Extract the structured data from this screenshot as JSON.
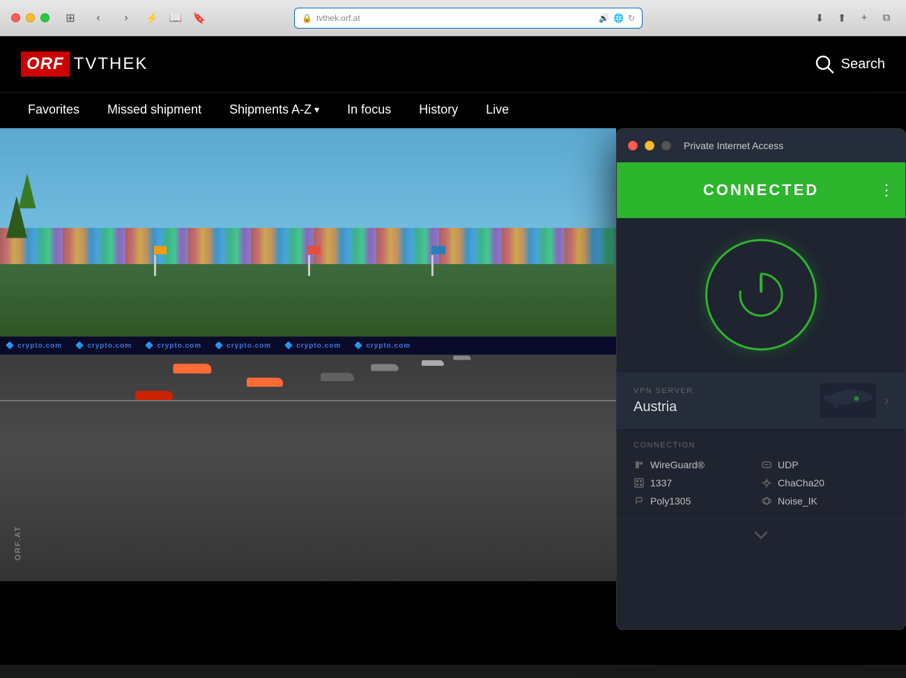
{
  "browser": {
    "title": "tvthek.orf.at",
    "traffic_lights": [
      "red",
      "yellow",
      "green"
    ],
    "url": "tvthek.orf.at",
    "url_secure_icon": "🔒"
  },
  "orf": {
    "logo_orf": "ORF",
    "logo_tvthek": "TVTHEK",
    "search_label": "Search",
    "nav": {
      "items": [
        {
          "label": "Favorites",
          "id": "favorites"
        },
        {
          "label": "Missed shipment",
          "id": "missed-shipment"
        },
        {
          "label": "Shipments A-Z",
          "id": "shipments-az",
          "dropdown": true
        },
        {
          "label": "In focus",
          "id": "in-focus"
        },
        {
          "label": "History",
          "id": "history"
        },
        {
          "label": "Live",
          "id": "live"
        }
      ]
    }
  },
  "pia": {
    "app_name": "Private Internet Access",
    "status": "CONNECTED",
    "vpn_server_label": "VPN SERVER",
    "vpn_server_name": "Austria",
    "connection_label": "CONNECTION",
    "connection_items": [
      {
        "icon": "pencil",
        "value": "WireGuard®",
        "side": "left"
      },
      {
        "icon": "shield",
        "value": "UDP",
        "side": "right"
      },
      {
        "icon": "grid",
        "value": "1337",
        "side": "left"
      },
      {
        "icon": "lock",
        "value": "ChaCha20",
        "side": "right"
      },
      {
        "icon": "key",
        "value": "Poly1305",
        "side": "left"
      },
      {
        "icon": "cloud",
        "value": "Noise_IK",
        "side": "right"
      }
    ],
    "menu_dots": "⋮",
    "down_arrow": "⌄"
  }
}
